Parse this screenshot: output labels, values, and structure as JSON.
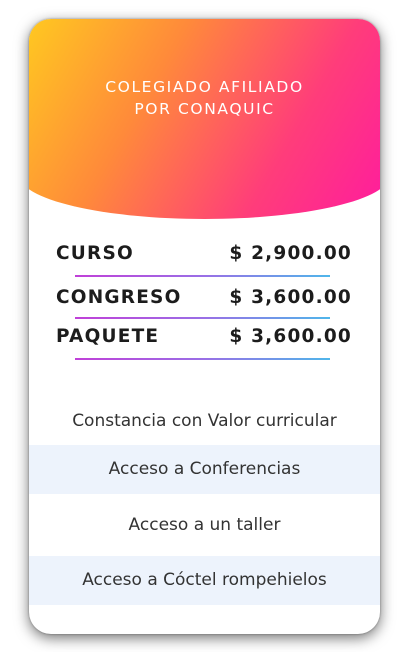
{
  "header": {
    "title_line1": "COLEGIADO AFILIADO",
    "title_line2": "POR CONAQUIC"
  },
  "prices": [
    {
      "name": "CURSO",
      "amount": "$ 2,900.00"
    },
    {
      "name": "CONGRESO",
      "amount": "$ 3,600.00"
    },
    {
      "name": "PAQUETE",
      "amount": "$ 3,600.00"
    }
  ],
  "features": [
    "Constancia con Valor curricular",
    "Acceso a Conferencias",
    "Acceso a un taller",
    "Acceso a Cóctel rompehielos"
  ],
  "colors": {
    "gradient_start": "#ffcc1f",
    "gradient_end": "#ff1aa0",
    "divider_start": "#c040d8",
    "divider_end": "#4fb6ea",
    "feature_stripe": "#edf3fc"
  }
}
